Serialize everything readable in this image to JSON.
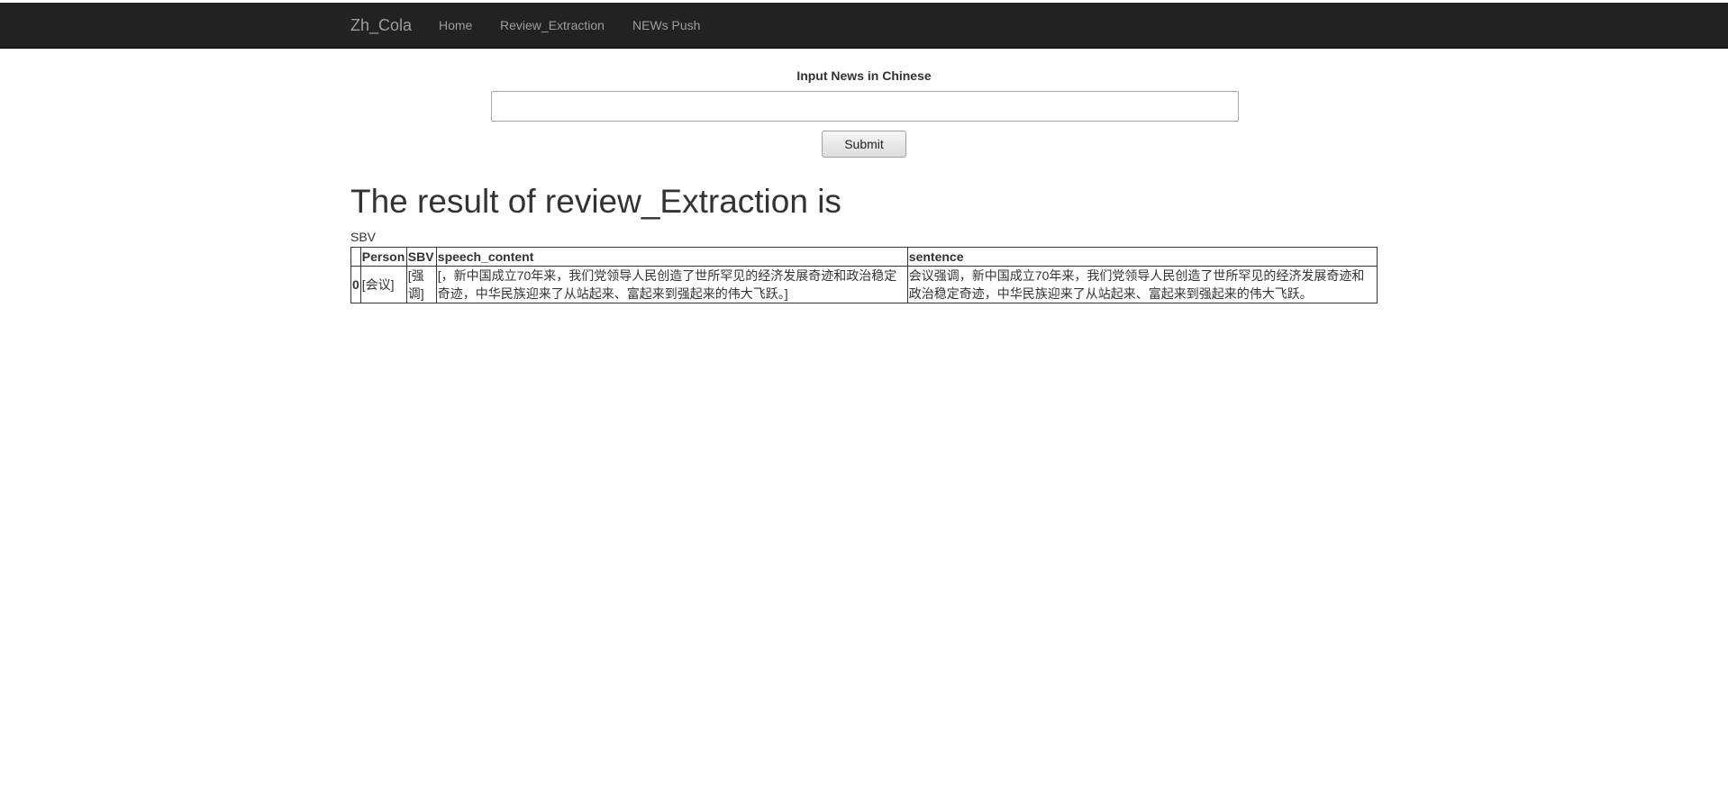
{
  "nav": {
    "brand": "Zh_Cola",
    "items": [
      {
        "label": "Home"
      },
      {
        "label": "Review_Extraction"
      },
      {
        "label": "NEWs Push"
      }
    ]
  },
  "form": {
    "label": "Input News in Chinese",
    "input_value": "",
    "submit_label": "Submit"
  },
  "result": {
    "title": "The result of review_Extraction is",
    "caption": "SBV",
    "table": {
      "columns": [
        "",
        "Person",
        "SBV",
        "speech_content",
        "sentence"
      ],
      "rows": [
        {
          "index": "0",
          "person": "[会议]",
          "sbv": "[强调]",
          "speech_content": "[，新中国成立70年来，我们党领导人民创造了世所罕见的经济发展奇迹和政治稳定奇迹，中华民族迎来了从站起来、富起来到强起来的伟大飞跃。]",
          "sentence": "会议强调，新中国成立70年来，我们党领导人民创造了世所罕见的经济发展奇迹和政治稳定奇迹，中华民族迎来了从站起来、富起来到强起来的伟大飞跃。"
        }
      ]
    }
  }
}
